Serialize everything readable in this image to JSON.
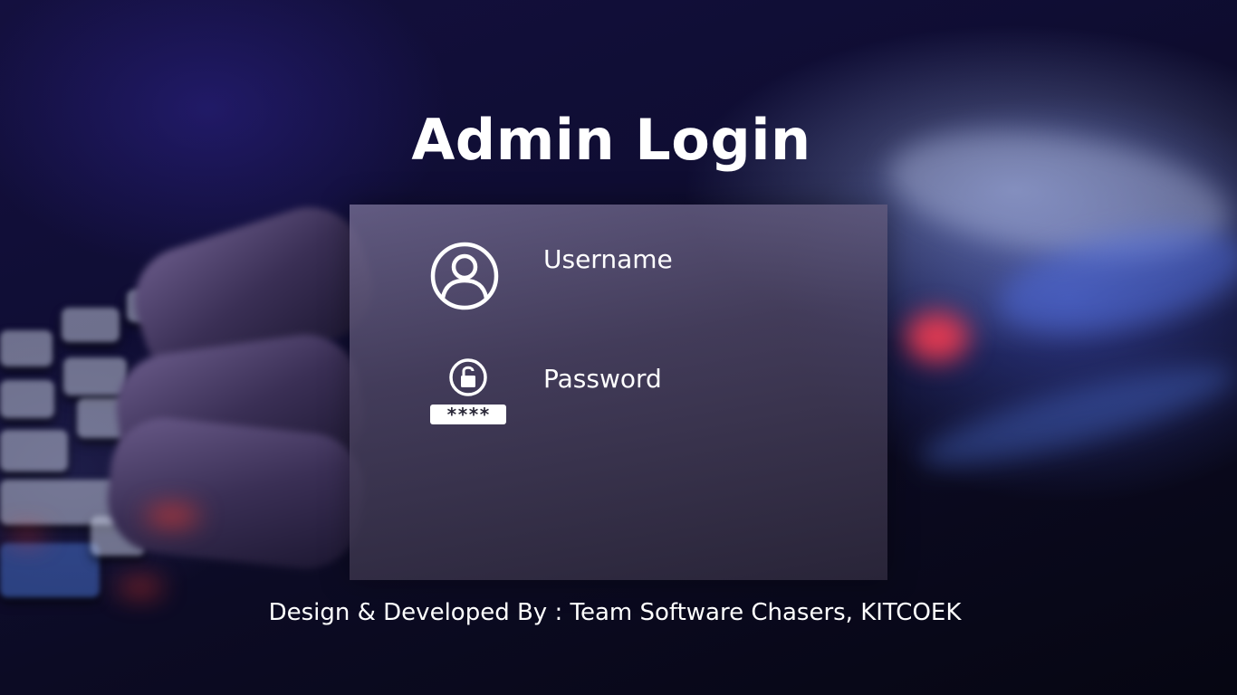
{
  "page": {
    "title": "Admin Login",
    "footer": "Design & Developed By : Team Software Chasers, KITCOEK"
  },
  "form": {
    "username": {
      "placeholder": "Username",
      "value": "",
      "icon": "user-circle-icon"
    },
    "password": {
      "placeholder": "Password",
      "value": "",
      "icon": "lock-password-icon",
      "mask": "****"
    }
  },
  "colors": {
    "text": "#ffffff",
    "panel": "#4e4664",
    "background": "#0f0d33"
  }
}
